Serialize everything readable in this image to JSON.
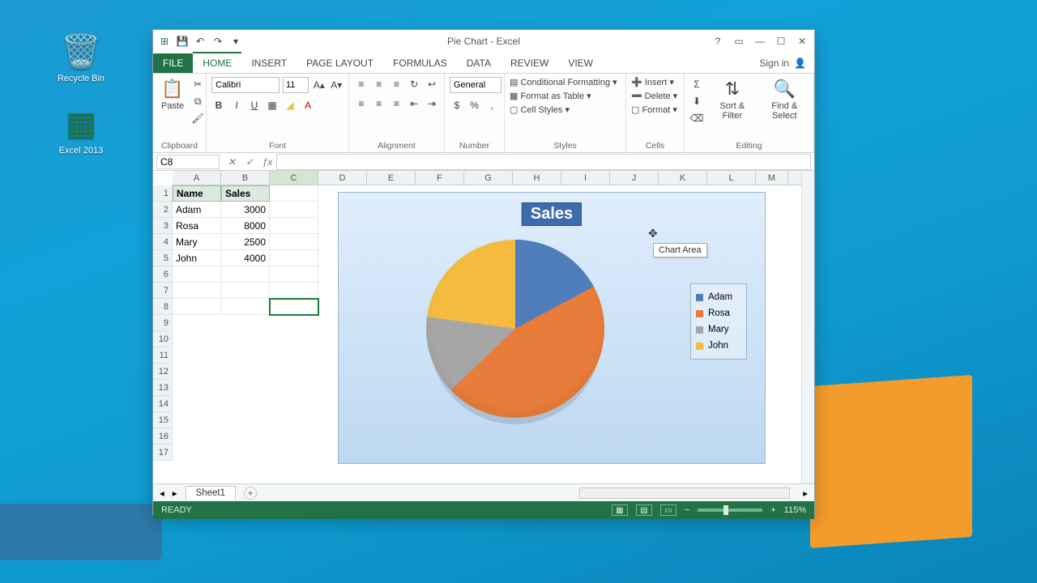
{
  "desktop": {
    "recycle_label": "Recycle Bin",
    "excel_label": "Excel 2013"
  },
  "titlebar": {
    "title": "Pie Chart - Excel"
  },
  "tabs": {
    "file": "FILE",
    "home": "HOME",
    "insert": "INSERT",
    "pagelayout": "PAGE LAYOUT",
    "formulas": "FORMULAS",
    "data": "DATA",
    "review": "REVIEW",
    "view": "VIEW",
    "signin": "Sign in"
  },
  "ribbon": {
    "clipboard": {
      "paste": "Paste",
      "label": "Clipboard"
    },
    "font": {
      "name": "Calibri",
      "size": "11",
      "label": "Font"
    },
    "alignment": {
      "label": "Alignment"
    },
    "number": {
      "format": "General",
      "label": "Number"
    },
    "styles": {
      "cond": "Conditional Formatting",
      "table": "Format as Table",
      "cell": "Cell Styles",
      "label": "Styles"
    },
    "cells": {
      "insert": "Insert",
      "delete": "Delete",
      "format": "Format",
      "label": "Cells"
    },
    "editing": {
      "sortfilter": "Sort & Filter",
      "findselect": "Find & Select",
      "label": "Editing"
    }
  },
  "fx": {
    "namebox": "C8"
  },
  "columns": [
    "A",
    "B",
    "C",
    "D",
    "E",
    "F",
    "G",
    "H",
    "I",
    "J",
    "K",
    "L",
    "M"
  ],
  "rows": [
    "1",
    "2",
    "3",
    "4",
    "5",
    "6",
    "7",
    "8",
    "9",
    "10",
    "11",
    "12",
    "13",
    "14",
    "15",
    "16",
    "17"
  ],
  "table": {
    "headers": {
      "name": "Name",
      "sales": "Sales"
    },
    "rows": [
      {
        "name": "Adam",
        "sales": "3000"
      },
      {
        "name": "Rosa",
        "sales": "8000"
      },
      {
        "name": "Mary",
        "sales": "2500"
      },
      {
        "name": "John",
        "sales": "4000"
      }
    ]
  },
  "chart": {
    "title": "Sales",
    "tooltip": "Chart Area",
    "legend": [
      "Adam",
      "Rosa",
      "Mary",
      "John"
    ],
    "colors": {
      "Adam": "#507ebc",
      "Rosa": "#e87c3a",
      "Mary": "#a6a6a6",
      "John": "#f4bb3e"
    }
  },
  "chart_data": {
    "type": "pie",
    "title": "Sales",
    "categories": [
      "Adam",
      "Rosa",
      "Mary",
      "John"
    ],
    "values": [
      3000,
      8000,
      2500,
      4000
    ]
  },
  "sheettabs": {
    "sheet1": "Sheet1"
  },
  "status": {
    "ready": "READY",
    "zoom": "115%"
  }
}
